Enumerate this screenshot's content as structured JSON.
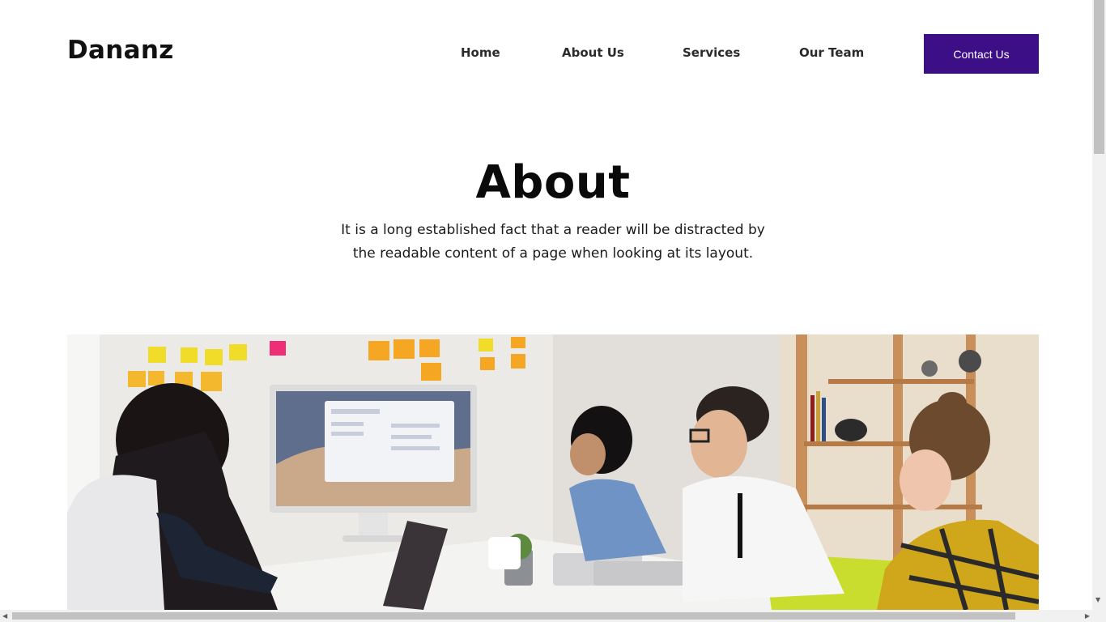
{
  "brand": {
    "logo": "Dananz"
  },
  "nav": {
    "items": [
      {
        "label": "Home"
      },
      {
        "label": "About Us"
      },
      {
        "label": "Services"
      },
      {
        "label": "Our Team"
      }
    ],
    "contact_label": "Contact Us"
  },
  "hero": {
    "title": "About",
    "text_line1": "It is a long established fact that a reader will be distracted by",
    "text_line2": "the readable content of a page when looking at its layout."
  },
  "colors": {
    "accent": "#3c0f87",
    "text": "#111111"
  },
  "icons": {
    "scroll_up": "triangle-up-icon",
    "scroll_down": "triangle-down-icon",
    "scroll_left": "triangle-left-icon",
    "scroll_right": "triangle-right-icon"
  }
}
